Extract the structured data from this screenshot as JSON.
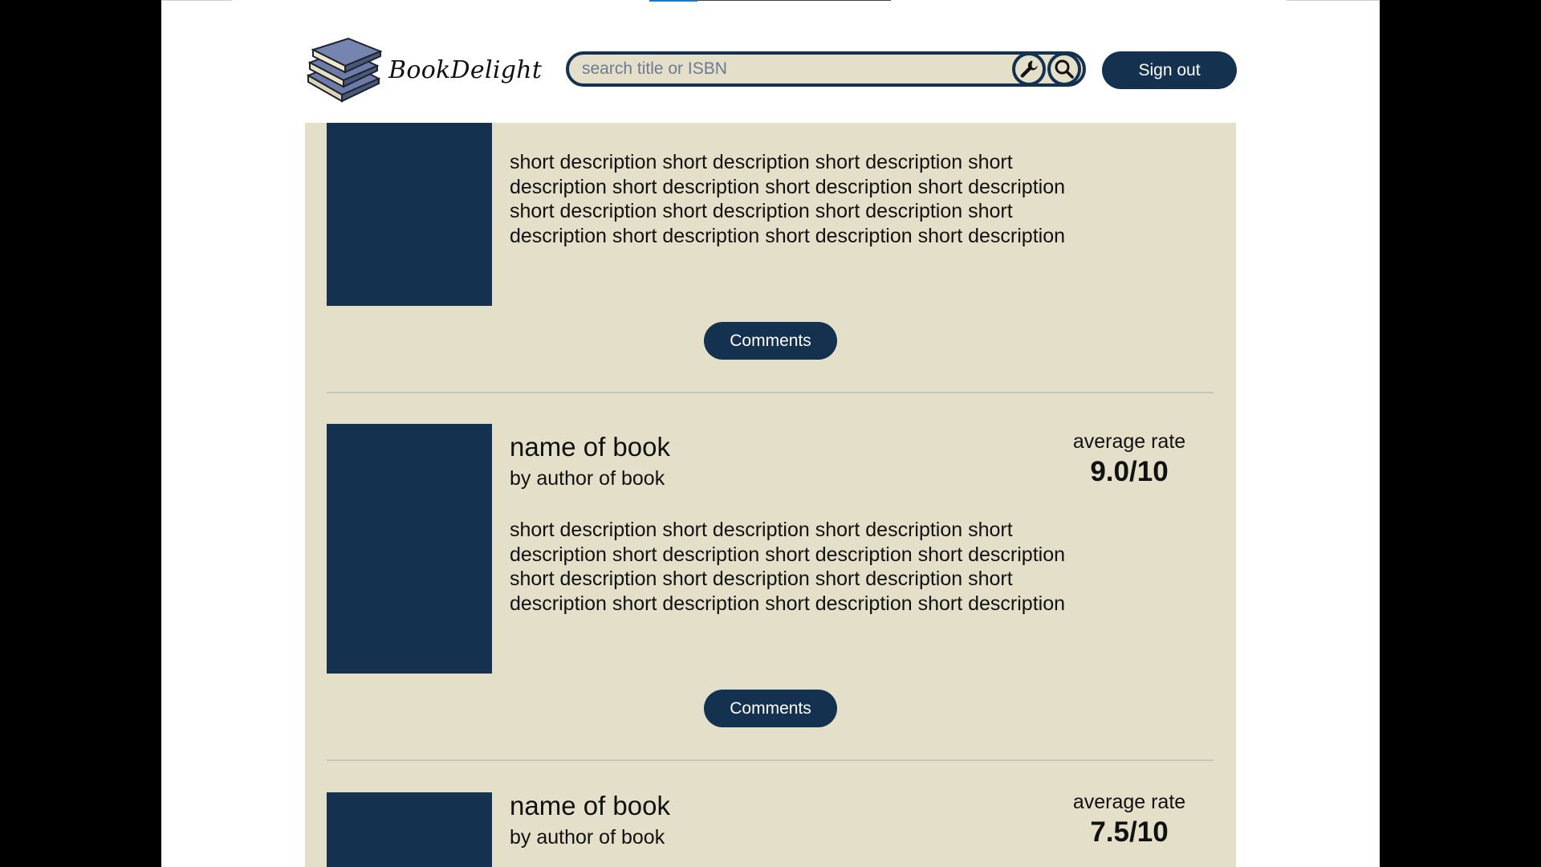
{
  "header": {
    "logo_text": "BookDelight",
    "search_placeholder": "search title or ISBN",
    "signout_label": "Sign out"
  },
  "books": [
    {
      "title": "",
      "author": "",
      "rate_label": "",
      "rate_value": "",
      "description": "short description short description short description  short\ndescription short description short description  short description\nshort description short description  short description short\ndescription  short description short description short description",
      "comments_label": "Comments"
    },
    {
      "title": "name of book",
      "author": "by author of book",
      "rate_label": "average rate",
      "rate_value": "9.0/10",
      "description": "short description short description short description  short\ndescription short description short description  short description\nshort description short description  short description short\ndescription  short description short description short description",
      "comments_label": "Comments"
    },
    {
      "title": "name of book",
      "author": "by author of book",
      "rate_label": "average rate",
      "rate_value": "7.5/10"
    }
  ],
  "colors": {
    "navy": "#14324f",
    "panel": "#e4dfc8",
    "backdrop": "#000000",
    "page": "#ffffff"
  }
}
